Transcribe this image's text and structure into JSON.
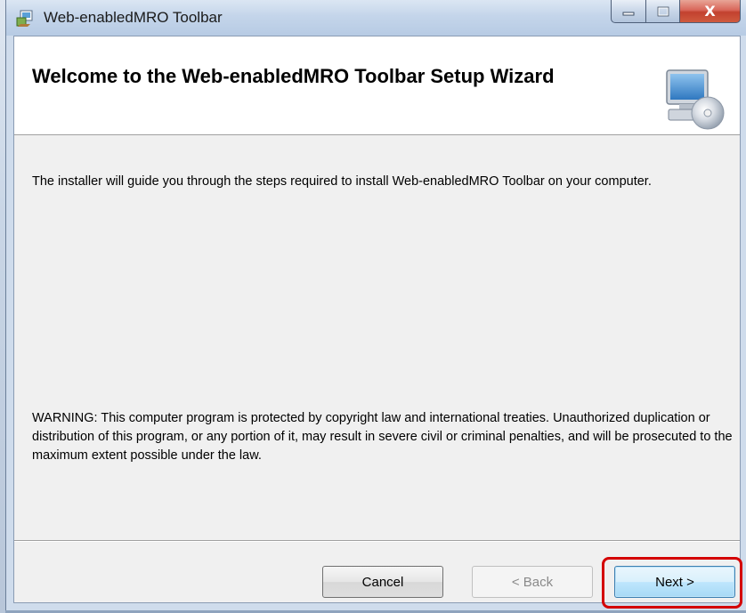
{
  "window": {
    "title": "Web-enabledMRO Toolbar",
    "controls": {
      "close_glyph": "X"
    }
  },
  "banner": {
    "title": "Welcome to the Web-enabledMRO Toolbar Setup Wizard",
    "icon": "computer-cd-icon"
  },
  "body": {
    "intro": "The installer will guide you through the steps required to install Web-enabledMRO Toolbar on your computer.",
    "warning": "WARNING: This computer program is protected by copyright law and international treaties. Unauthorized duplication or distribution of this program, or any portion of it, may result in severe civil or criminal penalties, and will be prosecuted to the maximum extent possible under the law."
  },
  "buttons": {
    "cancel": "Cancel",
    "back": "< Back",
    "next": "Next >"
  },
  "colors": {
    "highlight": "#d40000",
    "close_button": "#c2412f"
  }
}
